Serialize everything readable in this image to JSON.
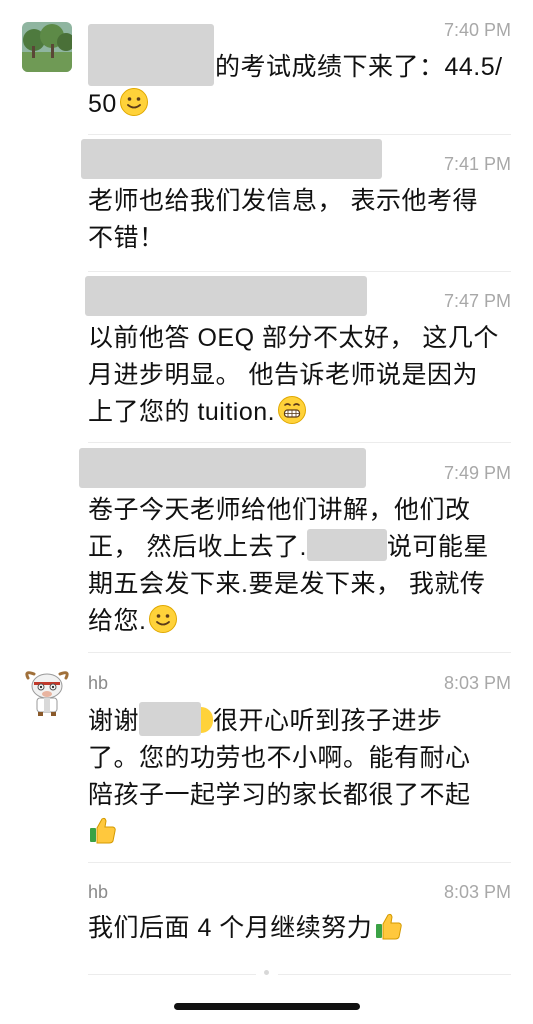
{
  "messages": [
    {
      "id": "m1",
      "sender": "",
      "time": "7:40 PM",
      "lines": [
        "的考试成绩下来了：44.5/",
        "50"
      ],
      "emoji": "smile-emoji"
    },
    {
      "id": "m2",
      "sender": "",
      "time": "7:41 PM",
      "lines": [
        "老师也给我们发信息， 表示他考得",
        "不错！"
      ]
    },
    {
      "id": "m3",
      "sender": "",
      "time": "7:47 PM",
      "lines": [
        "以前他答 OEQ 部分不太好， 这几个",
        "月进步明显。 他告诉老师说是因为",
        "上了您的 tuition."
      ],
      "emoji": "grin-emoji"
    },
    {
      "id": "m4",
      "sender": "",
      "time": "7:49 PM",
      "lines": [
        "卷子今天老师给他们讲解，他们改",
        "正， 然后收上去了.",
        "期五会发下来.要是发下来， 我就传",
        "给您."
      ],
      "line2_suffix": "说可能星",
      "emoji": "smile-emoji"
    },
    {
      "id": "m5",
      "sender": "hb",
      "time": "8:03 PM",
      "lines": [
        "谢谢",
        "很开心听到孩子进步",
        "了。您的功劳也不小啊。能有耐心",
        "陪孩子一起学习的家长都很了不起"
      ],
      "emoji": "thumbs-up-emoji"
    },
    {
      "id": "m6",
      "sender": "hb",
      "time": "8:03 PM",
      "lines": [
        "我们后面 4 个月继续努力"
      ],
      "emoji": "thumbs-up-emoji"
    }
  ]
}
